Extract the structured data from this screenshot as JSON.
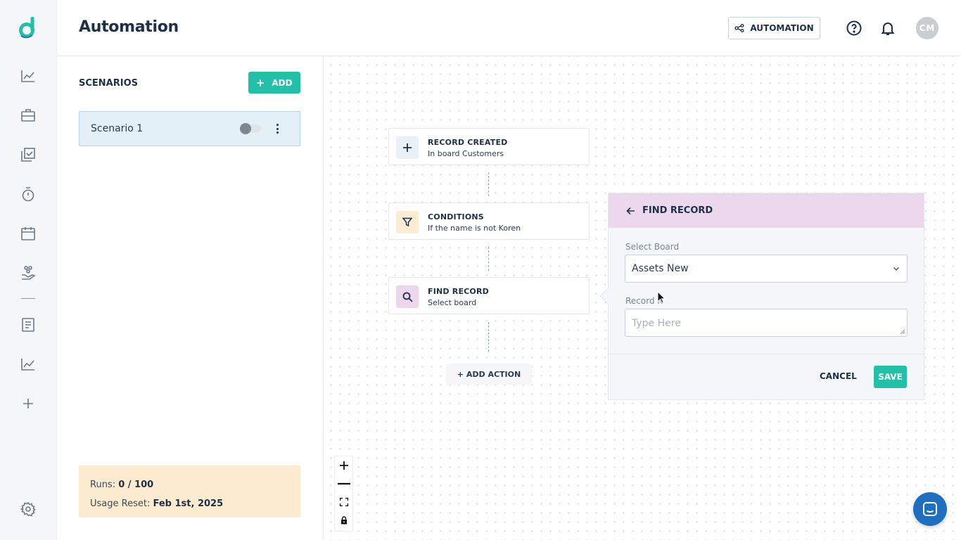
{
  "app": {
    "logo_letter": "d"
  },
  "header": {
    "title": "Automation",
    "automation_button": "AUTOMATION",
    "avatar_initials": "CM"
  },
  "sidebar": {
    "items": [
      {
        "icon": "chart-line-icon"
      },
      {
        "icon": "briefcase-icon"
      },
      {
        "icon": "checklist-icon"
      },
      {
        "icon": "stopwatch-icon"
      },
      {
        "icon": "calendar-icon"
      },
      {
        "icon": "hand-coins-icon"
      },
      {
        "icon": "document-icon"
      },
      {
        "icon": "analytics-icon"
      },
      {
        "icon": "plus-icon"
      }
    ],
    "settings_icon": "gear-icon"
  },
  "scenarios": {
    "title": "SCENARIOS",
    "add_label": "ADD",
    "items": [
      {
        "name": "Scenario 1",
        "enabled": false
      }
    ],
    "usage": {
      "runs_label": "Runs:",
      "runs_value": "0 / 100",
      "reset_label": "Usage Reset:",
      "reset_value": "Feb 1st, 2025"
    }
  },
  "flow": {
    "nodes": [
      {
        "title": "RECORD CREATED",
        "subtitle": "In board Customers",
        "icon": "plus-icon"
      },
      {
        "title": "CONDITIONS",
        "subtitle": "If the name is not Koren",
        "icon": "filter-icon"
      },
      {
        "title": "FIND RECORD",
        "subtitle": "Select board",
        "icon": "search-icon"
      }
    ],
    "add_action_label": "+ ADD ACTION"
  },
  "form": {
    "title": "FIND RECORD",
    "board_label": "Select Board",
    "board_value": "Assets New",
    "record_label": "Record N",
    "record_placeholder": "Type Here",
    "cancel_label": "CANCEL",
    "save_label": "SAVE"
  },
  "colors": {
    "accent": "#22c1a7",
    "navy": "#1c3148",
    "form_header": "#ecd7ec",
    "usage_bg": "#fdebd0",
    "chat_fab": "#1f6fbf"
  }
}
